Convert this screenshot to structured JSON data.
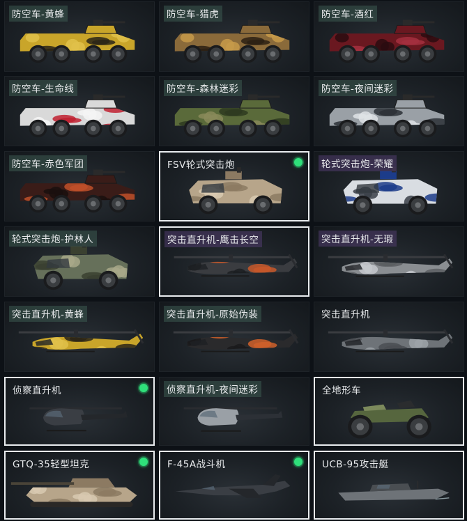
{
  "vehicles": [
    {
      "name": "防空车-黄蜂",
      "kind": "ifv",
      "camo": "yellow-black",
      "tag": "green",
      "selected": false,
      "owned_dot": false
    },
    {
      "name": "防空车-猎虎",
      "kind": "ifv",
      "camo": "tiger",
      "tag": "green",
      "selected": false,
      "owned_dot": false
    },
    {
      "name": "防空车-酒红",
      "kind": "ifv",
      "camo": "wine-red",
      "tag": "green",
      "selected": false,
      "owned_dot": false
    },
    {
      "name": "防空车-生命线",
      "kind": "ifv",
      "camo": "lifeline",
      "tag": "green",
      "selected": false,
      "owned_dot": false
    },
    {
      "name": "防空车-森林迷彩",
      "kind": "ifv",
      "camo": "forest",
      "tag": "green",
      "selected": false,
      "owned_dot": false
    },
    {
      "name": "防空车-夜间迷彩",
      "kind": "ifv",
      "camo": "night",
      "tag": "green",
      "selected": false,
      "owned_dot": false
    },
    {
      "name": "防空车-赤色军团",
      "kind": "ifv",
      "camo": "red-legion",
      "tag": "green",
      "selected": false,
      "owned_dot": false
    },
    {
      "name": "FSV轮式突击炮",
      "kind": "armored-car",
      "camo": "desert",
      "tag": "none",
      "selected": true,
      "owned_dot": true
    },
    {
      "name": "轮式突击炮-荣耀",
      "kind": "armored-car",
      "camo": "glory",
      "tag": "purple",
      "selected": false,
      "owned_dot": false
    },
    {
      "name": "轮式突击炮-护林人",
      "kind": "armored-car",
      "camo": "ranger",
      "tag": "green",
      "selected": false,
      "owned_dot": false
    },
    {
      "name": "突击直升机-鹰击长空",
      "kind": "helicopter",
      "camo": "hawk",
      "tag": "purple",
      "selected": true,
      "owned_dot": false
    },
    {
      "name": "突击直升机-无瑕",
      "kind": "helicopter",
      "camo": "flawless",
      "tag": "purple",
      "selected": false,
      "owned_dot": false
    },
    {
      "name": "突击直升机-黄蜂",
      "kind": "helicopter",
      "camo": "yellow-black",
      "tag": "green",
      "selected": false,
      "owned_dot": false
    },
    {
      "name": "突击直升机-原始伪装",
      "kind": "helicopter",
      "camo": "primal",
      "tag": "green",
      "selected": false,
      "owned_dot": false
    },
    {
      "name": "突击直升机",
      "kind": "helicopter",
      "camo": "grey",
      "tag": "none",
      "selected": false,
      "owned_dot": false
    },
    {
      "name": "侦察直升机",
      "kind": "scout-heli",
      "camo": "dark",
      "tag": "none",
      "selected": true,
      "owned_dot": true
    },
    {
      "name": "侦察直升机-夜间迷彩",
      "kind": "scout-heli",
      "camo": "night",
      "tag": "green",
      "selected": false,
      "owned_dot": false
    },
    {
      "name": "全地形车",
      "kind": "atv",
      "camo": "green",
      "tag": "none",
      "selected": true,
      "owned_dot": false
    },
    {
      "name": "GTQ-35轻型坦克",
      "kind": "tank",
      "camo": "desert",
      "tag": "none",
      "selected": true,
      "owned_dot": true
    },
    {
      "name": "F-45A战斗机",
      "kind": "jet",
      "camo": "dark",
      "tag": "none",
      "selected": true,
      "owned_dot": true
    },
    {
      "name": "UCB-95攻击艇",
      "kind": "boat",
      "camo": "grey",
      "tag": "none",
      "selected": true,
      "owned_dot": false
    }
  ],
  "colors": {
    "selected_border": "#e9ecef",
    "owned_dot": "#2fe07a",
    "background": "#0d1116",
    "card": "#1c2126"
  }
}
